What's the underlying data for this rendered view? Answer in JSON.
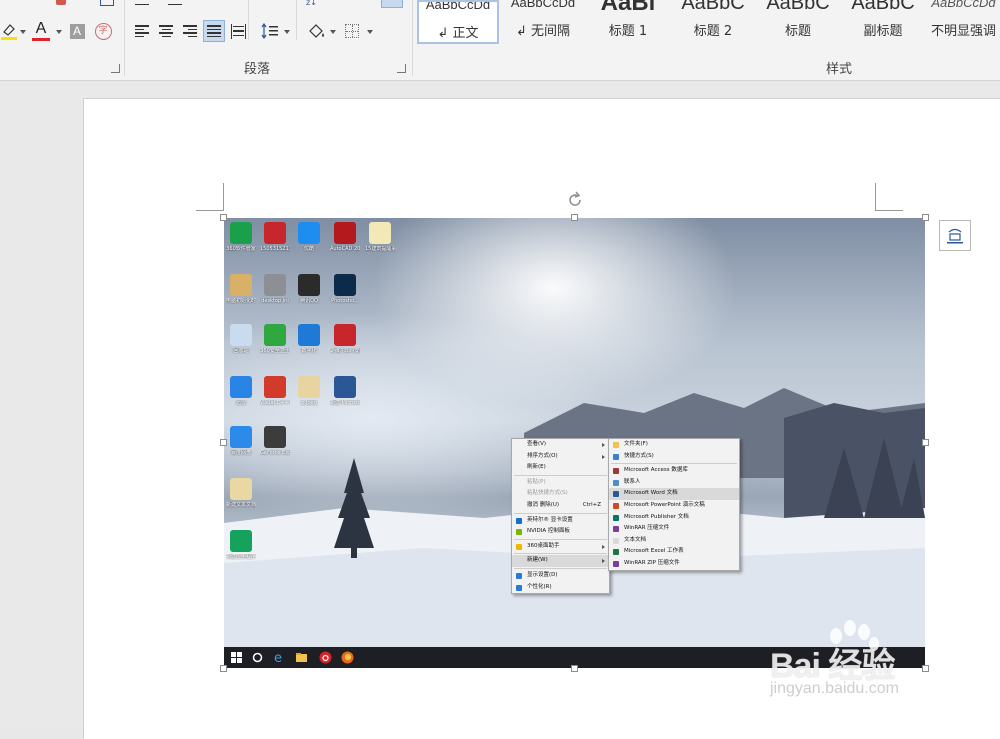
{
  "ribbon": {
    "font_group": {
      "font_color_letter": "A",
      "shading_letter": "A",
      "phonetic_char": "字",
      "font_color": "#e0242b",
      "highlight_color": "#f4e400"
    },
    "paragraph_group": {
      "label": "段落"
    },
    "styles_group": {
      "label": "样式",
      "items": [
        {
          "sample": "AaBbCcDd",
          "name": "↲ 正文",
          "selected": true
        },
        {
          "sample": "AaBbCcDd",
          "name": "↲ 无间隔",
          "selected": false
        },
        {
          "sample": "AaBl",
          "name": "标题 1",
          "selected": false
        },
        {
          "sample": "AaBbC",
          "name": "标题 2",
          "selected": false
        },
        {
          "sample": "AaBbC",
          "name": "标题",
          "selected": false
        },
        {
          "sample": "AaBbC",
          "name": "副标题",
          "selected": false
        },
        {
          "sample": "AaBbCcDd",
          "name": "不明显强调",
          "selected": false
        }
      ]
    }
  },
  "screenshot": {
    "desktop_icons": [
      {
        "label": "360软件管家",
        "color": "#1aa04b",
        "icon": "grid-icon"
      },
      {
        "label": "150531521工程量计算",
        "color": "#c8262d",
        "icon": "app-s-icon"
      },
      {
        "label": "优酷",
        "color": "#1d8ef0",
        "icon": "play-icon"
      },
      {
        "label": "AutoCAD 2011 - S...",
        "color": "#b3191d",
        "icon": "autocad-icon"
      },
      {
        "label": "15建筑提醒事项",
        "color": "#f3e9b6",
        "icon": "document-icon"
      },
      {
        "label": "电脑初始化时",
        "color": "#d9b067",
        "icon": "folder-icon"
      },
      {
        "label": "desktop.ini",
        "color": "#8c8f94",
        "icon": "file-icon"
      },
      {
        "label": "腾讯QQ",
        "color": "#2b2b2b",
        "icon": "qq-icon"
      },
      {
        "label": "Photosho...",
        "color": "#0c2b4a",
        "icon": "photoshop-icon"
      },
      {
        "label": "回收站",
        "color": "#c9dcef",
        "icon": "recycle-bin-icon"
      },
      {
        "label": "360安全卫士",
        "color": "#2ea83f",
        "icon": "shield-plus-icon"
      },
      {
        "label": "数字化",
        "color": "#1e7ad6",
        "icon": "sigma-icon"
      },
      {
        "label": "斯维尔BIM安装工程...",
        "color": "#c8262d",
        "icon": "app-s-icon"
      },
      {
        "label": "迅雷",
        "color": "#2a84e6",
        "icon": "bird-icon"
      },
      {
        "label": "Visual C++ 6.0",
        "color": "#d23b2c",
        "icon": "visual-cpp-icon"
      },
      {
        "label": "p.jpeg",
        "color": "#e7d4a0",
        "icon": "image-icon"
      },
      {
        "label": "新建 Microsof...",
        "color": "#2b5797",
        "icon": "word-icon"
      },
      {
        "label": "百度网盘",
        "color": "#2c8be9",
        "icon": "cloud-icon"
      },
      {
        "label": "GeForce Experience",
        "color": "#3c3c3c",
        "icon": "nvidia-icon"
      },
      {
        "label": "新建文本文档",
        "color": "#e9d7a4",
        "icon": "text-file-icon"
      },
      {
        "label": "新建应用程序",
        "color": "#15a25c",
        "icon": "app-s-icon"
      }
    ],
    "context_menu": {
      "items": [
        {
          "label": "查看(V)",
          "submenu": true
        },
        {
          "label": "排序方式(O)",
          "submenu": true
        },
        {
          "label": "刷新(E)"
        },
        {
          "sep": true
        },
        {
          "label": "粘贴(P)",
          "disabled": true
        },
        {
          "label": "粘贴快捷方式(S)",
          "disabled": true
        },
        {
          "label": "撤消 删除(U)",
          "shortcut": "Ctrl+Z"
        },
        {
          "sep": true
        },
        {
          "label": "英特尔® 显卡设置",
          "icon_color": "#1072c4"
        },
        {
          "label": "NVIDIA 控制面板",
          "icon_color": "#76b900"
        },
        {
          "sep": true
        },
        {
          "label": "360桌面助手",
          "submenu": true,
          "icon_color": "#f2b500"
        },
        {
          "sep": true
        },
        {
          "label": "新建(W)",
          "submenu": true,
          "highlighted": true
        },
        {
          "sep": true
        },
        {
          "label": "显示设置(D)",
          "icon_color": "#2a7bd6"
        },
        {
          "label": "个性化(R)",
          "icon_color": "#2a7bd6"
        }
      ]
    },
    "new_submenu": {
      "items": [
        {
          "label": "文件夹(F)",
          "icon_color": "#f2c14e"
        },
        {
          "label": "快捷方式(S)",
          "icon_color": "#3b7ed6"
        },
        {
          "sep": true
        },
        {
          "label": "Microsoft Access 数据库",
          "icon_color": "#a4373a"
        },
        {
          "label": "联系人",
          "icon_color": "#4f8fc9"
        },
        {
          "label": "Microsoft Word 文档",
          "icon_color": "#2b5797",
          "highlighted": true
        },
        {
          "label": "Microsoft PowerPoint 演示文稿",
          "icon_color": "#d24726"
        },
        {
          "label": "Microsoft Publisher 文档",
          "icon_color": "#077568"
        },
        {
          "label": "WinRAR 压缩文件",
          "icon_color": "#7b3e9e"
        },
        {
          "label": "文本文档",
          "icon_color": "#d9d9d9"
        },
        {
          "label": "Microsoft Excel 工作表",
          "icon_color": "#217346"
        },
        {
          "label": "WinRAR ZIP 压缩文件",
          "icon_color": "#7b3e9e"
        }
      ]
    },
    "taskbar": {
      "icons": [
        "windows-start-icon",
        "cortana-circle-icon",
        "edge-icon",
        "file-explorer-icon",
        "netease-music-icon",
        "firefox-icon"
      ]
    }
  },
  "watermark": {
    "logo_text": "Bai 经验",
    "url": "jingyan.baidu.com"
  }
}
